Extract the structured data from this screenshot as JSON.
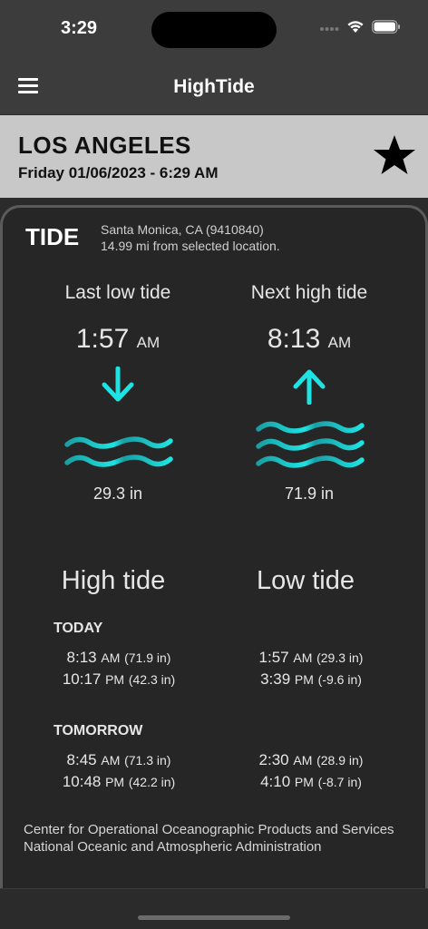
{
  "status": {
    "time": "3:29"
  },
  "nav": {
    "title": "HighTide"
  },
  "location": {
    "city": "LOS ANGELES",
    "datetime": "Friday 01/06/2023 - 6:29 AM"
  },
  "tide": {
    "label": "TIDE",
    "station_line1": "Santa Monica, CA (9410840)",
    "station_line2": "14.99 mi from selected location.",
    "last_low": {
      "title": "Last low tide",
      "time": "1:57",
      "ampm": "AM",
      "height": "29.3 in"
    },
    "next_high": {
      "title": "Next high tide",
      "time": "8:13",
      "ampm": "AM",
      "height": "71.9 in"
    }
  },
  "schedule": {
    "high_title": "High tide",
    "low_title": "Low tide",
    "today": {
      "label": "TODAY",
      "high": [
        {
          "time": "8:13",
          "ampm": "AM",
          "height": "(71.9 in)"
        },
        {
          "time": "10:17",
          "ampm": "PM",
          "height": "(42.3 in)"
        }
      ],
      "low": [
        {
          "time": "1:57",
          "ampm": "AM",
          "height": "(29.3 in)"
        },
        {
          "time": "3:39",
          "ampm": "PM",
          "height": "(-9.6 in)"
        }
      ]
    },
    "tomorrow": {
      "label": "TOMORROW",
      "high": [
        {
          "time": "8:45",
          "ampm": "AM",
          "height": "(71.3 in)"
        },
        {
          "time": "10:48",
          "ampm": "PM",
          "height": "(42.2 in)"
        }
      ],
      "low": [
        {
          "time": "2:30",
          "ampm": "AM",
          "height": "(28.9 in)"
        },
        {
          "time": "4:10",
          "ampm": "PM",
          "height": "(-8.7 in)"
        }
      ]
    }
  },
  "credits": {
    "line1": "Center for Operational Oceanographic Products and Services",
    "line2": "National Oceanic and Atmospheric Administration"
  },
  "colors": {
    "accent": "#1ee3e3",
    "wave_dark": "#1a9ea3"
  }
}
